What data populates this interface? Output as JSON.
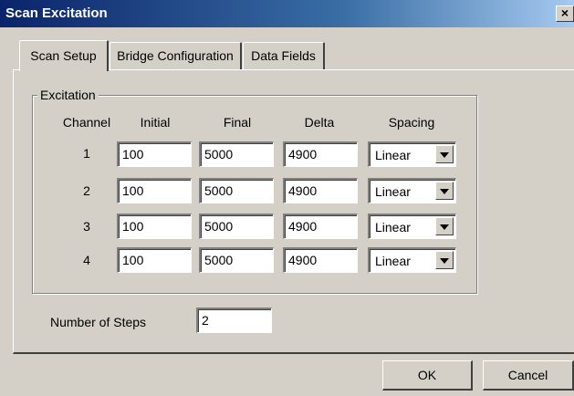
{
  "window": {
    "title": "Scan Excitation",
    "close_glyph": "×"
  },
  "tabs": [
    {
      "label": "Scan Setup",
      "active": true
    },
    {
      "label": "Bridge Configuration",
      "active": false
    },
    {
      "label": "Data Fields",
      "active": false
    }
  ],
  "excitation": {
    "group_label": "Excitation",
    "headers": {
      "channel": "Channel",
      "initial": "Initial",
      "final": "Final",
      "delta": "Delta",
      "spacing": "Spacing"
    },
    "rows": [
      {
        "channel": "1",
        "initial": "100",
        "final": "5000",
        "delta": "4900",
        "spacing": "Linear"
      },
      {
        "channel": "2",
        "initial": "100",
        "final": "5000",
        "delta": "4900",
        "spacing": "Linear"
      },
      {
        "channel": "3",
        "initial": "100",
        "final": "5000",
        "delta": "4900",
        "spacing": "Linear"
      },
      {
        "channel": "4",
        "initial": "100",
        "final": "5000",
        "delta": "4900",
        "spacing": "Linear"
      }
    ]
  },
  "steps": {
    "label": "Number of Steps",
    "value": "2"
  },
  "buttons": {
    "ok": "OK",
    "cancel": "Cancel"
  },
  "colors": {
    "titlebar_start": "#0a246a",
    "titlebar_end": "#a6caf0",
    "face": "#d4d0c8"
  }
}
